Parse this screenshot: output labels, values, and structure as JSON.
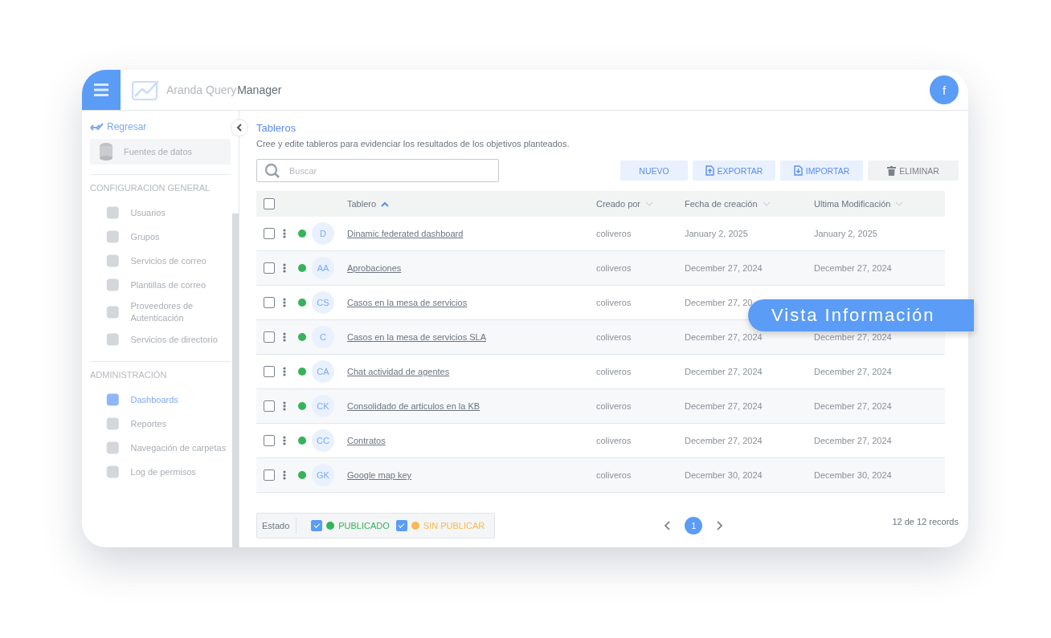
{
  "app": {
    "brand": "Aranda Query",
    "product": "Manager",
    "user_initial": "f"
  },
  "sidebar": {
    "back_link": "Regresar",
    "module": "Fuentes de datos",
    "sections": [
      {
        "heading": "CONFIGURACION GENERAL",
        "items": [
          {
            "label": "Usuarios",
            "selected": false
          },
          {
            "label": "Grupos",
            "selected": false
          },
          {
            "label": "Servicios de correo",
            "selected": false
          },
          {
            "label": "Plantillas de correo",
            "selected": false
          },
          {
            "label": "Proveedores de Autenticación",
            "selected": false
          },
          {
            "label": "Servicios de directorio",
            "selected": false
          }
        ]
      },
      {
        "heading": "ADMINISTRACIÓN",
        "items": [
          {
            "label": "Dashboards",
            "selected": true
          },
          {
            "label": "Reportes",
            "selected": false
          },
          {
            "label": "Navegación de carpetas",
            "selected": false
          },
          {
            "label": "Log de permisos",
            "selected": false
          }
        ]
      }
    ]
  },
  "page": {
    "title": "Tableros",
    "subtitle": "Cree y edite tableros para evidenciar los resultados de los objetivos planteados."
  },
  "search": {
    "placeholder": "Buscar"
  },
  "actions": [
    {
      "label": "NUEVO",
      "kind": "new",
      "disabled": false
    },
    {
      "label": "EXPORTAR",
      "kind": "export",
      "disabled": false
    },
    {
      "label": "IMPORTAR",
      "kind": "import",
      "disabled": false
    },
    {
      "label": "ELIMINAR",
      "kind": "delete",
      "disabled": true
    }
  ],
  "table": {
    "all_checked": false,
    "columns": [
      {
        "label": "Tablero",
        "sorted": true
      },
      {
        "label": "Creado por",
        "sorted": false
      },
      {
        "label": "Fecha de creación",
        "sorted": false
      },
      {
        "label": "Ultima Modificación",
        "sorted": false
      }
    ],
    "rows": [
      {
        "checked": false,
        "color": "#34b35a",
        "initials": "D",
        "name": "Dinamic federated dashboard",
        "created_by": "coliveros",
        "created": "January 2, 2025",
        "modified": "January 2, 2025"
      },
      {
        "checked": false,
        "color": "#34b35a",
        "initials": "AA",
        "name": "Aprobaciones",
        "created_by": "coliveros",
        "created": "December 27, 2024",
        "modified": "December 27, 2024"
      },
      {
        "checked": false,
        "color": "#34b35a",
        "initials": "CS",
        "name": "Casos en la mesa de servicios",
        "created_by": "coliveros",
        "created": "December 27, 20"
      },
      {
        "checked": false,
        "color": "#34b35a",
        "initials": "C",
        "name": "Casos en la mesa de servicios SLA",
        "created_by": "coliveros",
        "created": "December 27, 2024",
        "modified": "December 27, 2024"
      },
      {
        "checked": false,
        "color": "#34b35a",
        "initials": "CA",
        "name": "Chat actividad de agentes",
        "created_by": "coliveros",
        "created": "December 27, 2024",
        "modified": "December 27, 2024"
      },
      {
        "checked": false,
        "color": "#34b35a",
        "initials": "CK",
        "name": "Consolidado de articulos en la KB",
        "created_by": "coliveros",
        "created": "December 27, 2024",
        "modified": "December 27, 2024"
      },
      {
        "checked": false,
        "color": "#34b35a",
        "initials": "CC",
        "name": "Contratos",
        "created_by": "coliveros",
        "created": "December 27, 2024",
        "modified": "December 27, 2024"
      },
      {
        "checked": false,
        "color": "#34b35a",
        "initials": "GK",
        "name": "Google map key",
        "created_by": "coliveros",
        "created": "December 30, 2024",
        "modified": "December 30, 2024"
      }
    ]
  },
  "filter": {
    "label": "Estado",
    "options": [
      {
        "label": "PUBLICADO",
        "checked": true,
        "color": "#34b35a"
      },
      {
        "label": "SIN PUBLICAR",
        "checked": true,
        "color": "#f7b955"
      }
    ]
  },
  "pagination": {
    "pages": [
      {
        "label": "1",
        "selected": true
      }
    ],
    "records": "12 de 12 records"
  },
  "banner": "Vista Información"
}
